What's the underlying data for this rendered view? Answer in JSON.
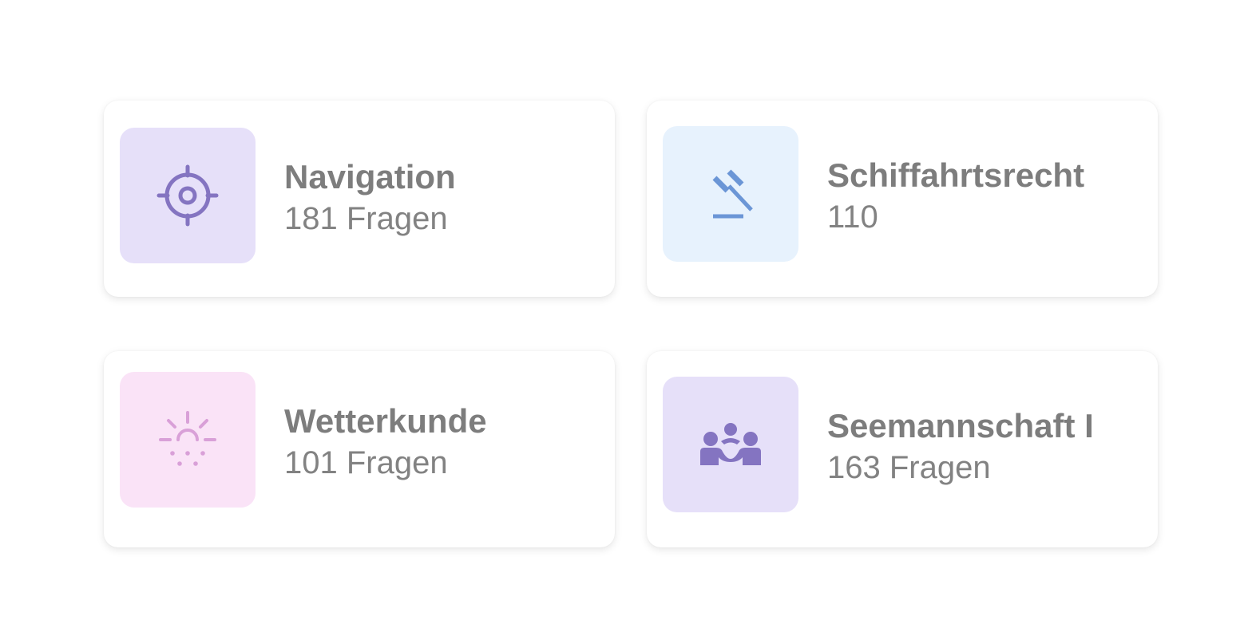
{
  "cards": [
    {
      "title": "Navigation",
      "subtitle": "181 Fragen",
      "icon": "crosshair-icon",
      "tile_color": "#e6e0f9",
      "icon_color": "#8474c1"
    },
    {
      "title": "Schiffahrtsrecht",
      "subtitle": "110",
      "icon": "gavel-icon",
      "tile_color": "#e7f2fd",
      "icon_color": "#6b96d6"
    },
    {
      "title": "Wetterkunde",
      "subtitle": "101 Fragen",
      "icon": "sun-rain-icon",
      "tile_color": "#fae3f7",
      "icon_color": "#d9a0d8"
    },
    {
      "title": "Seemannschaft I",
      "subtitle": "163 Fragen",
      "icon": "group-icon",
      "tile_color": "#e6e0f9",
      "icon_color": "#8474c1"
    }
  ]
}
